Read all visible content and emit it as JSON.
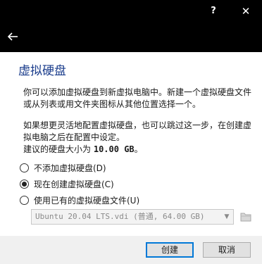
{
  "titlebar": {
    "help_label": "?",
    "close_label": "✕"
  },
  "nav": {
    "back_icon": "arrow-left-icon"
  },
  "wizard": {
    "title": "虚拟硬盘",
    "paragraph1": "你可以添加虚拟硬盘到新虚拟电脑中。新建一个虚拟硬盘文件或从列表或用文件夹图标从其他位置选择一个。",
    "paragraph2": "如果想更灵活地配置虚拟硬盘，也可以跳过这一步，在创建虚拟电脑之后在配置中设定。",
    "size_prefix": "建议的硬盘大小为",
    "size_value": "10.00 GB",
    "size_suffix": "。"
  },
  "options": [
    {
      "label": "不添加虚拟硬盘(D)",
      "checked": false
    },
    {
      "label": "现在创建虚拟硬盘(C)",
      "checked": true
    },
    {
      "label": "使用已有的虚拟硬盘文件(U)",
      "checked": false
    }
  ],
  "existing_disk": {
    "selected": "Ubuntu 20.04 LTS.vdi (普通, 64.00 GB)",
    "enabled": false,
    "browse_icon": "folder-icon"
  },
  "footer": {
    "create_label": "创建",
    "cancel_label": "取消"
  },
  "colors": {
    "titlebar": "#000000",
    "header_text": "#1b3d8c",
    "default_button_border": "#0078d7"
  }
}
